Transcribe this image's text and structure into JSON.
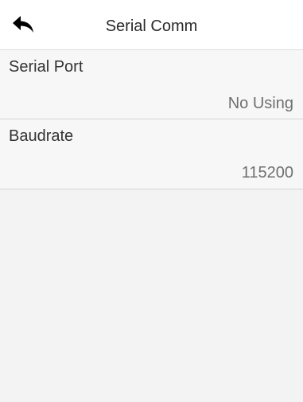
{
  "header": {
    "title": "Serial Comm",
    "back_icon": "back-arrow-icon"
  },
  "settings": [
    {
      "label": "Serial Port",
      "value": "No Using"
    },
    {
      "label": "Baudrate",
      "value": "115200"
    }
  ]
}
